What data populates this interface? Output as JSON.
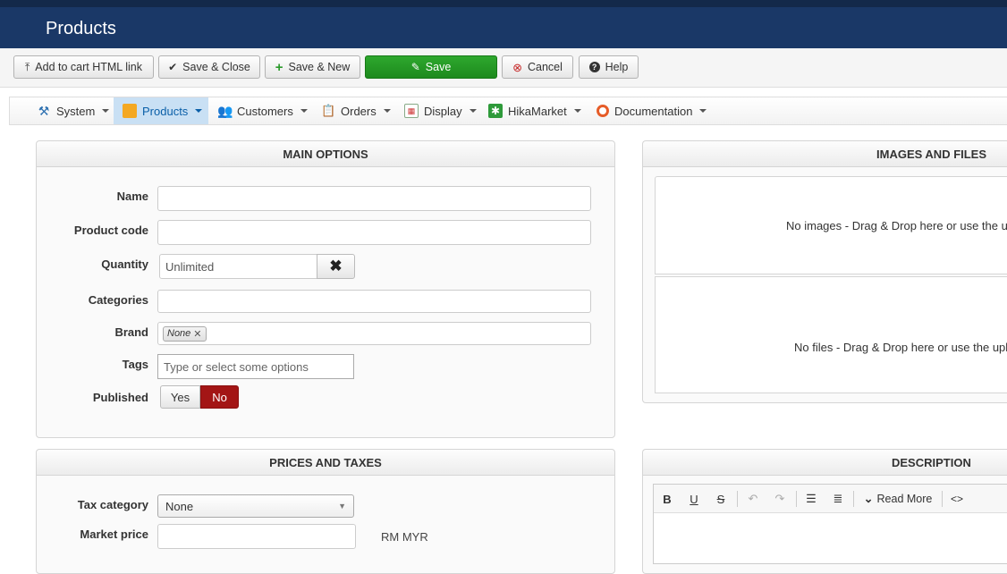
{
  "header": {
    "title": "Products"
  },
  "toolbar": {
    "add_to_cart": "Add to cart HTML link",
    "save_close": "Save & Close",
    "save_new": "Save & New",
    "save": "Save",
    "cancel": "Cancel",
    "help": "Help"
  },
  "menu": {
    "items": [
      {
        "label": "System",
        "icon": "tools-icon"
      },
      {
        "label": "Products",
        "icon": "box-icon"
      },
      {
        "label": "Customers",
        "icon": "users-icon"
      },
      {
        "label": "Orders",
        "icon": "clipboard-icon"
      },
      {
        "label": "Display",
        "icon": "calendar-icon"
      },
      {
        "label": "HikaMarket",
        "icon": "star-icon"
      },
      {
        "label": "Documentation",
        "icon": "lifebuoy-icon"
      }
    ],
    "active": "Products"
  },
  "main_options": {
    "title": "MAIN OPTIONS",
    "name_label": "Name",
    "name_value": "",
    "code_label": "Product code",
    "code_value": "",
    "quantity_label": "Quantity",
    "quantity_value": "Unlimited",
    "categories_label": "Categories",
    "brand_label": "Brand",
    "brand_tag": "None",
    "tags_label": "Tags",
    "tags_placeholder": "Type or select some options",
    "published_label": "Published",
    "published_yes": "Yes",
    "published_no": "No",
    "published_selected": "No"
  },
  "images_files": {
    "title": "IMAGES AND FILES",
    "no_images": "No images - Drag & Drop here or use the u",
    "no_files": "No files - Drag & Drop here or use the upl"
  },
  "prices": {
    "title": "PRICES AND TAXES",
    "tax_label": "Tax category",
    "tax_value": "None",
    "market_label": "Market price",
    "market_value": "",
    "currency": "RM MYR"
  },
  "description": {
    "title": "DESCRIPTION",
    "read_more": "Read More"
  },
  "colors": {
    "header_bg": "#1a3867",
    "save_green": "#1d8a1d",
    "published_no_red": "#a31515",
    "menu_active": "#c9e0f4"
  }
}
